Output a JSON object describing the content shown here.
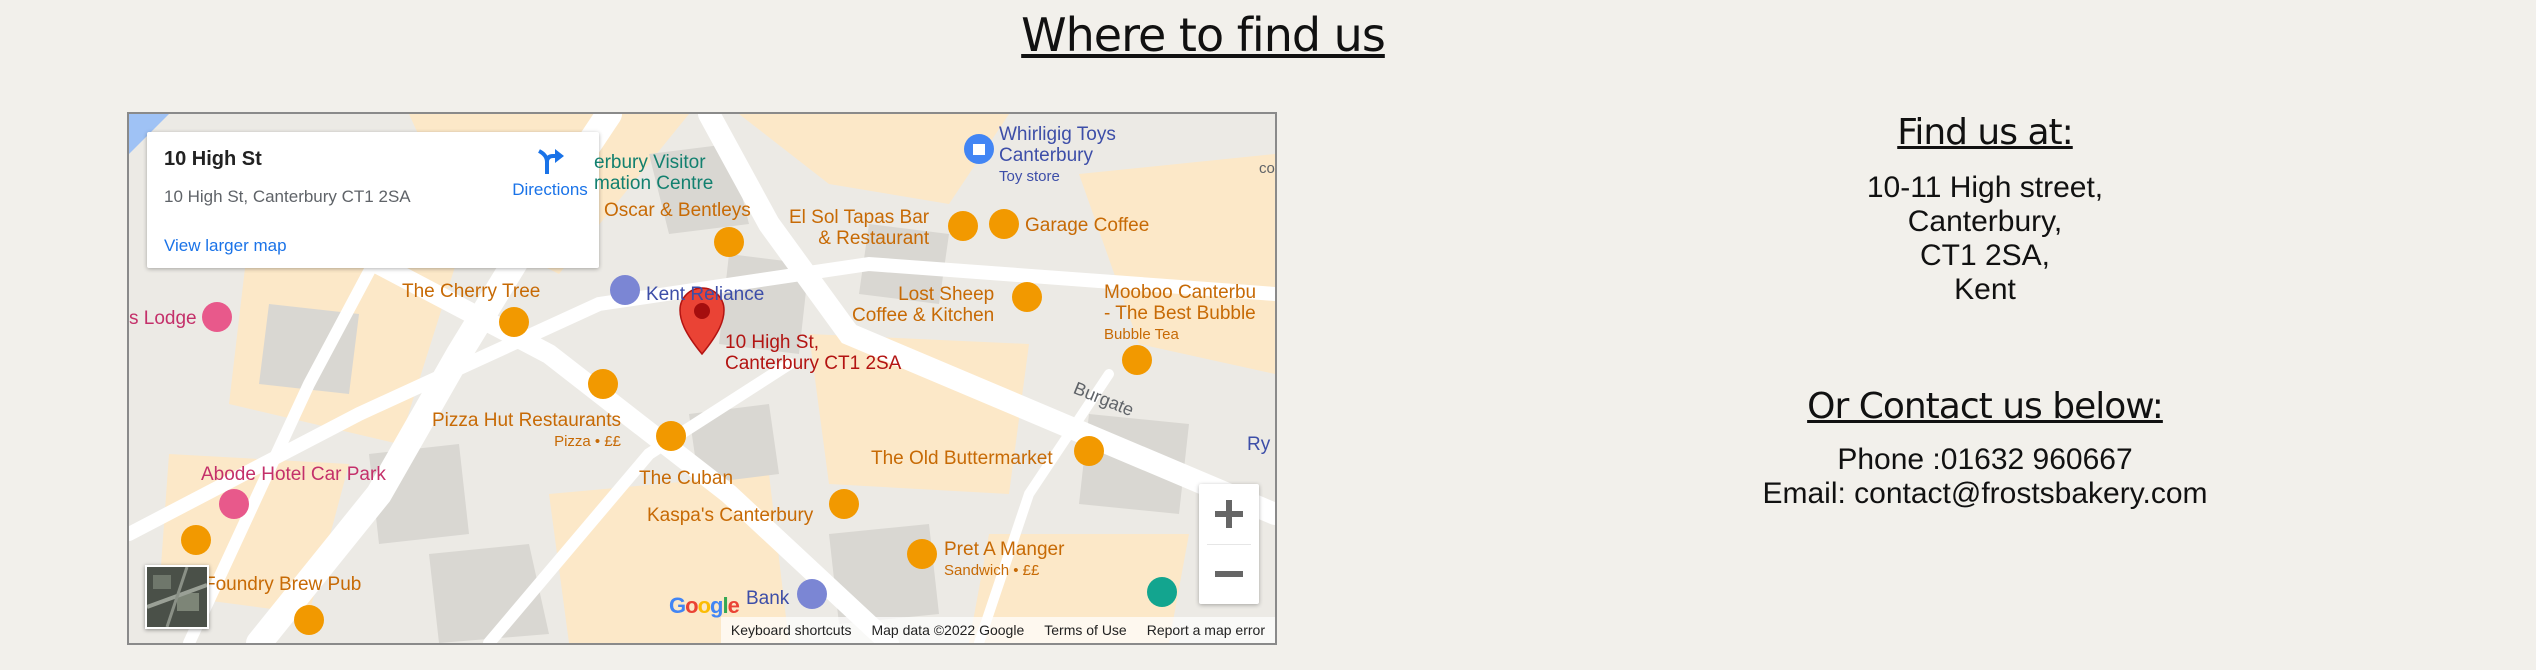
{
  "page": {
    "title": "Where to find us"
  },
  "map": {
    "card": {
      "title": "10 High St",
      "address": "10 High St, Canterbury CT1 2SA",
      "directions": "Directions",
      "larger": "View larger map"
    },
    "pois": {
      "whirligig": "Whirligig Toys",
      "whirligig2": "Canterbury",
      "toy_store": "Toy store",
      "visitor1": "erbury Visitor",
      "visitor2": "mation Centre",
      "oscar": "Oscar & Bentleys",
      "elsol1": "El Sol Tapas Bar",
      "elsol2": "& Restaurant",
      "garage": "Garage Coffee",
      "cherry": "The Cherry Tree",
      "kent": "Kent Reliance",
      "lostsheep1": "Lost Sheep",
      "lostsheep2": "Coffee & Kitchen",
      "mooboo1": "Mooboo Canterbu",
      "mooboo2": "- The Best Bubble",
      "bubble": "Bubble Tea",
      "lodge": "s Lodge",
      "marker1": "10 High St,",
      "marker2": "Canterbury CT1 2SA",
      "burgate": "Burgate",
      "pizzahut": "Pizza Hut Restaurants",
      "pizza_sub": "Pizza • ££",
      "abode": "Abode Hotel Car Park",
      "cuban": "The Cuban",
      "butter": "The Old Buttermarket",
      "kaspa": "Kaspa's Canterbury",
      "pret": "Pret A Manger",
      "pret_sub": "Sandwich • ££",
      "foundry": "Foundry Brew Pub",
      "bank": "Bank",
      "ry": "Ry",
      "co": "co"
    },
    "google_logo": "Google",
    "footer": {
      "shortcuts": "Keyboard shortcuts",
      "mapdata": "Map data ©2022 Google",
      "terms": "Terms of Use",
      "report": "Report a map error"
    }
  },
  "contact": {
    "find_heading": "Find us at:",
    "address": [
      "10-11 High street,",
      "Canterbury,",
      "CT1 2SA,",
      "Kent"
    ],
    "contact_heading": "Or Contact us below:",
    "phone": "Phone :01632 960667",
    "email": "Email: contact@frostsbakery.com"
  },
  "colors": {
    "poi_orange": "#c76a05",
    "link_blue": "#1a73e8",
    "marker_red": "#ea4335",
    "background": "#f2f0eb"
  }
}
